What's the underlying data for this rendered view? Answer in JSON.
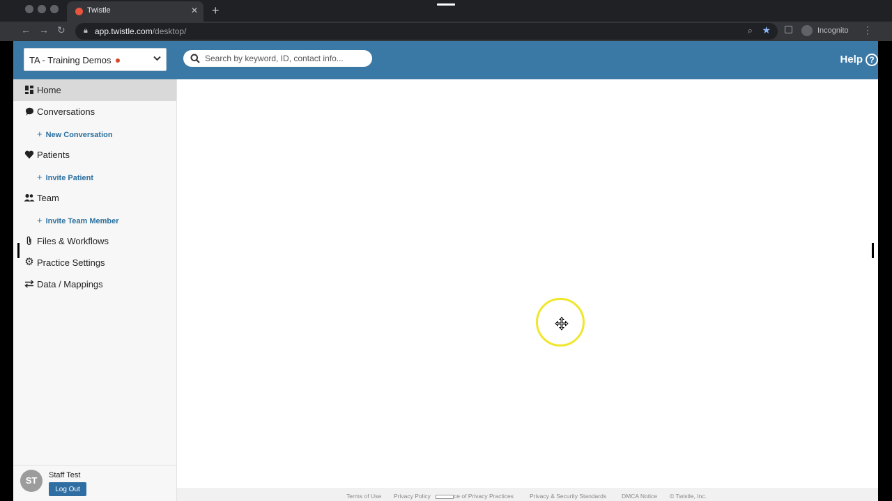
{
  "browser": {
    "tab_title": "Twistle",
    "url_host": "app.twistle.com",
    "url_path": "/desktop/",
    "incognito_label": "Incognito"
  },
  "header": {
    "practice": "TA - Training Demos",
    "search_placeholder": "Search by keyword, ID, contact info...",
    "help_label": "Help"
  },
  "sidebar": {
    "items": [
      {
        "label": "Home",
        "icon": "dashboard-icon"
      },
      {
        "label": "Conversations",
        "icon": "chat-icon"
      },
      {
        "label": "New Conversation",
        "icon": "plus-icon"
      },
      {
        "label": "Patients",
        "icon": "heart-icon"
      },
      {
        "label": "Invite Patient",
        "icon": "plus-icon"
      },
      {
        "label": "Team",
        "icon": "people-icon"
      },
      {
        "label": "Invite Team Member",
        "icon": "plus-icon"
      },
      {
        "label": "Files & Workflows",
        "icon": "paperclip-icon"
      },
      {
        "label": "Practice Settings",
        "icon": "gear-icon"
      },
      {
        "label": "Data / Mappings",
        "icon": "swap-icon"
      }
    ]
  },
  "user": {
    "initials": "ST",
    "name": "Staff Test",
    "logout_label": "Log Out"
  },
  "footer": {
    "links": [
      "Terms of Use",
      "Privacy Policy",
      "ce of Privacy Practices",
      "Privacy & Security Standards",
      "DMCA Notice",
      "© Twistle, Inc."
    ]
  },
  "colors": {
    "header_blue": "#3a78a6",
    "link_blue": "#2a6f9e",
    "status_dot": "#d9472b"
  }
}
